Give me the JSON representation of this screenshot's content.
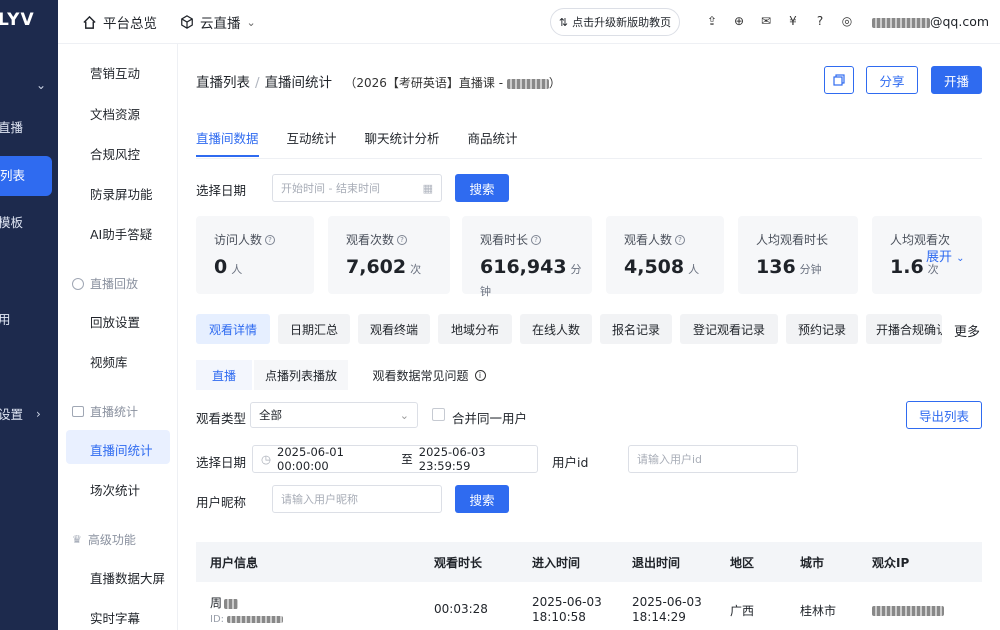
{
  "rail": {
    "logo": "LYV",
    "items": [
      {
        "label": "直播"
      },
      {
        "label": "列表"
      },
      {
        "label": "模板"
      },
      {
        "label": "用"
      },
      {
        "label": "设置"
      }
    ]
  },
  "sidebar": {
    "items": {
      "marketing": "营销互动",
      "docs": "文档资源",
      "compliance": "合规风控",
      "anti_record": "防录屏功能",
      "ai_assistant": "AI助手答疑",
      "playback_group": "直播回放",
      "playback_settings": "回放设置",
      "video_library": "视频库",
      "stats_group": "直播统计",
      "room_stats": "直播间统计",
      "session_stats": "场次统计",
      "advanced_group": "高级功能",
      "data_screen": "直播数据大屏",
      "subtitles": "实时字幕"
    }
  },
  "topbar": {
    "home": "平台总览",
    "cloud_live": "云直播",
    "upgrade": "点击升级新版助教页",
    "user_suffix": "@qq.com"
  },
  "header": {
    "crumb_list": "直播列表",
    "crumb_current": "直播间统计",
    "subtitle": "（2026【考研英语】直播课 -",
    "subtitle_end": "）",
    "share": "分享",
    "start": "开播"
  },
  "tabs": [
    "直播间数据",
    "互动统计",
    "聊天统计分析",
    "商品统计"
  ],
  "date_filter": {
    "label": "选择日期",
    "placeholder": "开始时间 - 结束时间",
    "search": "搜索"
  },
  "stats": [
    {
      "title": "访问人数",
      "value": "0",
      "unit": "人"
    },
    {
      "title": "观看次数",
      "value": "7,602",
      "unit": "次"
    },
    {
      "title": "观看时长",
      "value": "616,943",
      "unit": "分钟"
    },
    {
      "title": "观看人数",
      "value": "4,508",
      "unit": "人"
    },
    {
      "title": "人均观看时长",
      "value": "136",
      "unit": "分钟"
    },
    {
      "title": "人均观看次",
      "value": "1.6",
      "unit": "次"
    }
  ],
  "expand": "展开",
  "detail_tabs": [
    "观看详情",
    "日期汇总",
    "观看终端",
    "地域分布",
    "在线人数",
    "报名记录",
    "登记观看记录",
    "预约记录",
    "开播合规确认"
  ],
  "more": "更多",
  "mini_tabs": {
    "live": "直播",
    "vod": "点播列表播放",
    "faq": "观看数据常见问题"
  },
  "filters": {
    "type_label": "观看类型",
    "type_value": "全部",
    "merge_label": "合并同一用户",
    "export": "导出列表",
    "date_label": "选择日期",
    "date_from": "2025-06-01 00:00:00",
    "date_to_sep": "至",
    "date_to": "2025-06-03 23:59:59",
    "uid_label": "用户id",
    "uid_placeholder": "请输入用户id",
    "nick_label": "用户昵称",
    "nick_placeholder": "请输入用户昵称",
    "search": "搜索"
  },
  "table": {
    "headers": [
      "用户信息",
      "观看时长",
      "进入时间",
      "退出时间",
      "地区",
      "城市",
      "观众IP"
    ],
    "rows": [
      {
        "name": "周",
        "id_prefix": "ID:",
        "duration": "00:03:28",
        "enter_date": "2025-06-03",
        "enter_time": "18:10:58",
        "exit_date": "2025-06-03",
        "exit_time": "18:14:29",
        "region": "广西",
        "city": "桂林市"
      }
    ]
  }
}
